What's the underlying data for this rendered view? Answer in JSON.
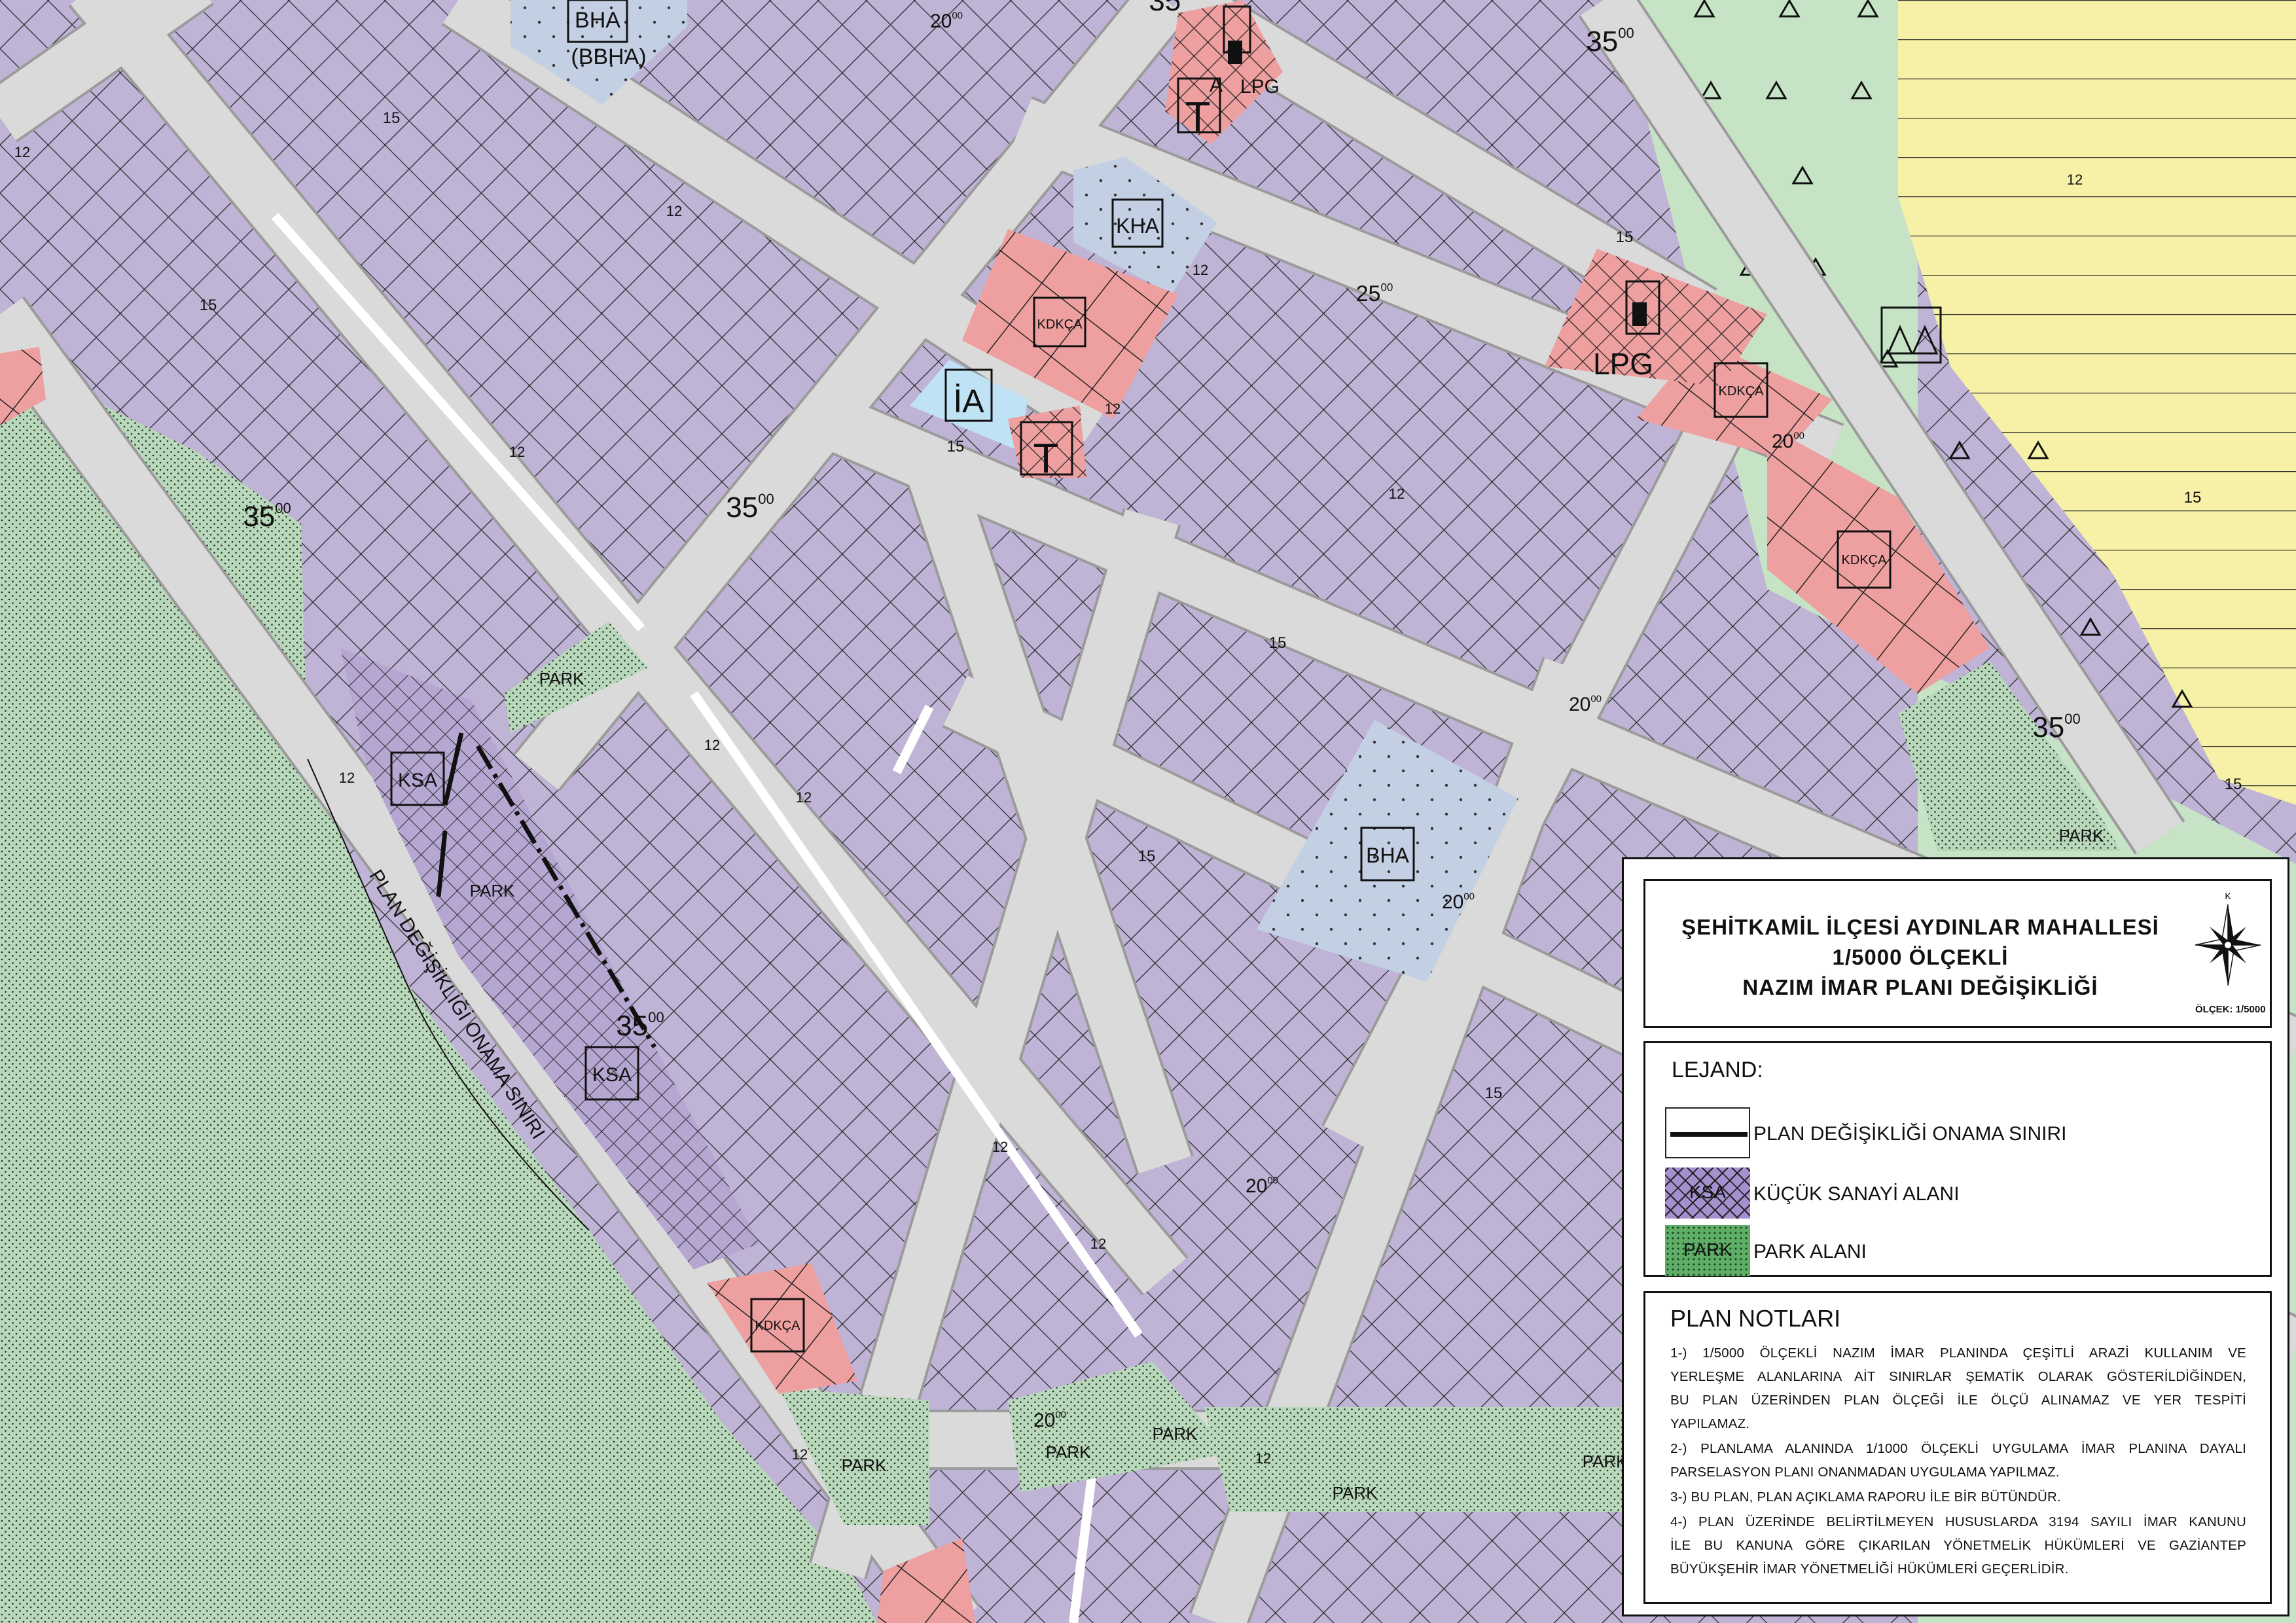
{
  "colors": {
    "small_industry_area": "#bfb3d6",
    "park_area": "#b9d7bb",
    "road": "#d9d9d9",
    "commercial_kdkca": "#ee9f9f",
    "municipal_service_bha": "#c0cde0",
    "education_ia": "#bfe3f5",
    "residential_yellow": "#f6f1a6",
    "afforestation_green": "#c6e3c6"
  },
  "map": {
    "zone_labels": {
      "bha_top": "BHA",
      "bbha": "(BBHA)",
      "kha": "KHA",
      "ia": "İA",
      "t_top": "T",
      "t_mid": "T",
      "lpg_top": "LPG",
      "a_top": "A",
      "lpg_right": "LPG",
      "kdkca_1": "KDKÇA",
      "kdkca_2": "KDKÇA",
      "kdkca_3": "KDKÇA",
      "kdkca_4": "KDKÇA",
      "bha_center": "BHA",
      "ksa_1": "KSA",
      "ksa_2": "KSA",
      "park_1": "PARK",
      "park_2": "PARK",
      "park_3": "PARK",
      "park_4": "PARK",
      "park_5": "PARK",
      "park_6": "PARK",
      "park_7": "PARK",
      "park_8": "PARK"
    },
    "road_widths": {
      "w35_a": "35",
      "w35_b": "35",
      "w35_c": "35",
      "w35_d": "35",
      "w35_e": "35",
      "w25": "25",
      "w20_a": "20",
      "w20_b": "20",
      "w20_c": "20",
      "w20_d": "20",
      "w20_e": "20",
      "w20_f": "20",
      "w15_a": "15",
      "w15_b": "15",
      "w15_c": "15",
      "w15_d": "15",
      "w15_e": "15",
      "w15_f": "15",
      "w15_g": "15",
      "w15_h": "15",
      "w15_i": "15",
      "w12_a": "12",
      "w12_b": "12",
      "w12_c": "12",
      "w12_d": "12",
      "w12_e": "12",
      "w12_f": "12",
      "w12_g": "12",
      "w12_h": "12",
      "w12_i": "12",
      "w12_j": "12",
      "w12_k": "12",
      "w12_l": "12",
      "w12_m": "12",
      "w12_n": "12",
      "sup": "00"
    },
    "boundary_label": "PLAN DEĞİŞİKLİĞİ ONAMA SINIRI"
  },
  "legend": {
    "title_line_1": "ŞEHİTKAMİL İLÇESİ AYDINLAR MAHALLESİ",
    "title_line_2": "1/5000 ÖLÇEKLİ",
    "title_line_3": "NAZIM İMAR PLANI DEĞİŞİKLİĞİ",
    "north_letter": "K",
    "scale": "ÖLÇEK: 1/5000",
    "heading": "LEJAND:",
    "items": [
      {
        "swatch_text": "",
        "label": "PLAN DEĞİŞİKLİĞİ ONAMA SINIRI"
      },
      {
        "swatch_text": "KSA",
        "label": "KÜÇÜK SANAYİ ALANI"
      },
      {
        "swatch_text": "PARK",
        "label": "PARK ALANI"
      }
    ]
  },
  "plan_notes": {
    "heading": "PLAN NOTLARI",
    "lines": [
      "1-) 1/5000 ÖLÇEKLİ NAZIM İMAR PLANINDA ÇEŞİTLİ ARAZİ KULLANIM VE",
      "YERLEŞME ALANLARINA AİT SINIRLAR ŞEMATİK OLARAK GÖSTERİLDİĞİNDEN,",
      "BU PLAN ÜZERİNDEN PLAN ÖLÇEĞİ İLE ÖLÇÜ ALINAMAZ VE YER TESPİTİ",
      "YAPILAMAZ.",
      "2-) PLANLAMA ALANINDA 1/1000 ÖLÇEKLİ UYGULAMA İMAR PLANINA DAYALI",
      "PARSELASYON PLANI ONANMADAN UYGULAMA YAPILMAZ.",
      "3-) BU PLAN, PLAN AÇIKLAMA RAPORU İLE BİR BÜTÜNDÜR.",
      "4-) PLAN ÜZERİNDE BELİRTİLMEYEN HUSUSLARDA 3194 SAYILI İMAR KANUNU",
      "İLE BU KANUNA GÖRE ÇIKARILAN YÖNETMELİK HÜKÜMLERİ VE GAZİANTEP",
      "BÜYÜKŞEHİR İMAR YÖNETMELİĞİ HÜKÜMLERİ GEÇERLİDİR."
    ]
  }
}
